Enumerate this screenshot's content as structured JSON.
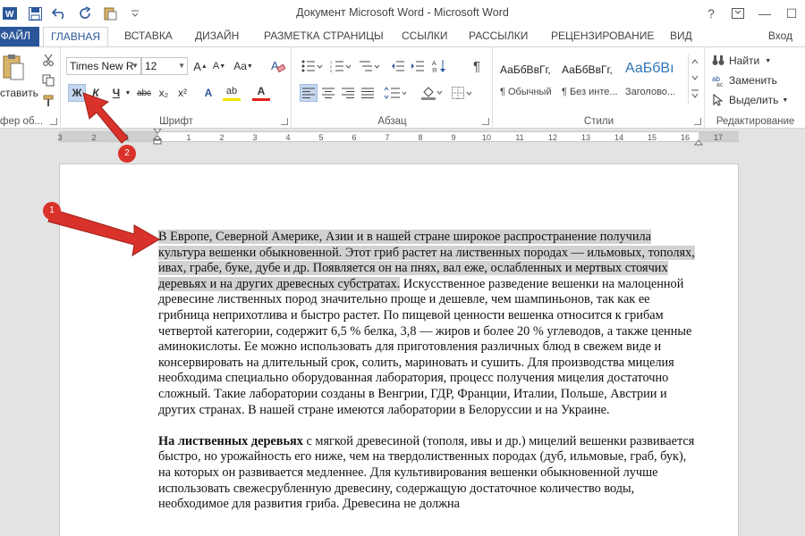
{
  "window": {
    "title": "Документ Microsoft Word - Microsoft Word",
    "help": "?",
    "minimize": "—",
    "restore": "☐",
    "close": "✕"
  },
  "tabs": [
    "ФАЙЛ",
    "ГЛАВНАЯ",
    "ВСТАВКА",
    "ДИЗАЙН",
    "РАЗМЕТКА СТРАНИЦЫ",
    "ССЫЛКИ",
    "РАССЫЛКИ",
    "РЕЦЕНЗИРОВАНИЕ",
    "ВИД"
  ],
  "signin": "Вход",
  "ribbon": {
    "clipboard": {
      "paste": "ставить",
      "label": "фер об..."
    },
    "font": {
      "name": "Times New R",
      "size": "12",
      "label": "Шрифт",
      "bold": "Ж",
      "italic": "К",
      "underline": "Ч",
      "strike": "abc",
      "sub": "x₂",
      "sup": "x²",
      "grow": "A",
      "shrink": "A",
      "case": "Aa",
      "effects": "A",
      "highlight": "ab",
      "color": "A"
    },
    "paragraph": {
      "label": "Абзац",
      "pilcrow": "¶"
    },
    "styles": {
      "label": "Стили",
      "items": [
        {
          "preview": "АаБбВвГг,",
          "name": "¶ Обычный"
        },
        {
          "preview": "АаБбВвГг,",
          "name": "¶ Без инте..."
        },
        {
          "preview": "АаБбВı",
          "name": "Заголово..."
        }
      ]
    },
    "editing": {
      "label": "Редактирование",
      "find": "Найти",
      "replace": "Заменить",
      "select": "Выделить"
    }
  },
  "ruler": {
    "left": [
      "3",
      "2",
      "1"
    ],
    "right": [
      "1",
      "2",
      "3",
      "4",
      "5",
      "6",
      "7",
      "8",
      "9",
      "10",
      "11",
      "12",
      "13",
      "14",
      "15",
      "16",
      "17"
    ]
  },
  "document": {
    "p1_highlighted": "В Европе, Северной Америке, Азии и в нашей стране широкое распространение получила культура вешенки обыкновенной. Этот гриб растет на лиственных породах — ильмовых, тополях, ивах, грабе, буке, дубе и др. Появляется он на пнях, вал еже, ослабленных и мертвых стоячих деревьях и на других древесных субстратах.",
    "p1_rest": " Искусственное разведение вешенки на малоценной древесине лиственных пород значительно проще и дешевле, чем шампиньонов, так как ее грибница неприхотлива и быстро растет. По пищевой ценности вешенка относится к грибам четвертой категории, содержит 6,5 % белка, 3,8 — жиров и более 20 % углеводов, а также ценные аминокислоты. Ее можно использовать для приготовления различных блюд в свежем виде и консервировать на длительный срок, солить, мариновать и сушить. Для производства мицелия необходима специально оборудованная лаборатория, процесс получения мицелия достаточно сложный. Такие лаборатории созданы в Венгрии, ГДР, Франции, Италии, Польше, Австрии и других странах. В нашей стране имеются лаборатории в Белоруссии и на Украине.",
    "p2_bold": "На лиственных деревьях",
    "p2_rest": " с мягкой древесиной (тополя, ивы и др.) мицелий вешенки развивается быстро, но урожайность его ниже, чем на твердолиственных породах (дуб, ильмовые, граб, бук), на которых он развивается медленнее. Для культивирования вешенки обыкновенной лучше использовать свежесрубленную древесину, содержащую достаточное количество воды, необходимое для развития гриба. Древесина не должна"
  },
  "annotations": {
    "badge1": "1",
    "badge2": "2"
  },
  "colors": {
    "accent": "#2b579a",
    "arrow": "#d9322a",
    "highlight": "#d2d2d2"
  }
}
